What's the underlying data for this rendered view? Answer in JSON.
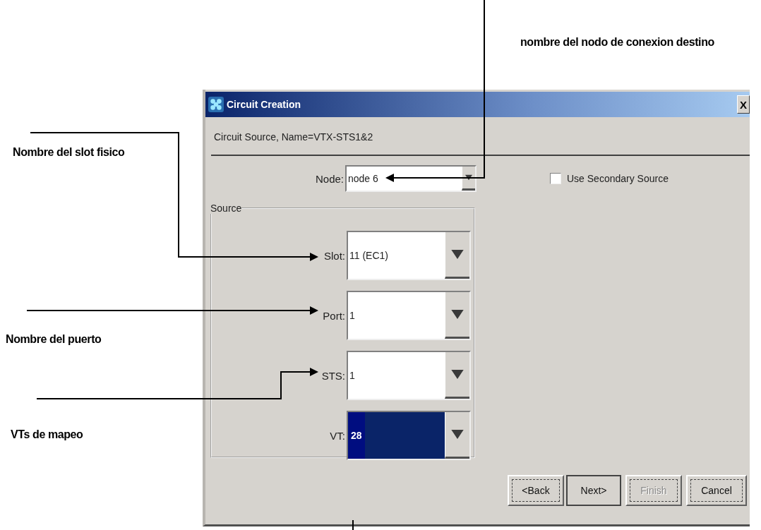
{
  "annotations": [
    {
      "text": "nombre del nodo de conexion destino"
    },
    {
      "text": "Nombre del slot fisico"
    },
    {
      "text": "Nombre del puerto"
    },
    {
      "text": "VTs de mapeo"
    }
  ],
  "window": {
    "title": "Circuit Creation",
    "close": "X"
  },
  "header": "Circuit Source, Name=VTX-STS1&2",
  "node": {
    "label": "Node:",
    "value": "node 6"
  },
  "use_secondary_source": {
    "label": "Use Secondary Source",
    "checked": false
  },
  "source_group": {
    "title": "Source",
    "fields": [
      {
        "label": "Slot:",
        "value": "11 (EC1)",
        "selected": false
      },
      {
        "label": "Port:",
        "value": "1",
        "selected": false
      },
      {
        "label": "STS:",
        "value": "1",
        "selected": false
      },
      {
        "label": "VT:",
        "value": "28",
        "selected": true
      }
    ]
  },
  "buttons": [
    {
      "label": "<Back",
      "disabled": false,
      "default": false
    },
    {
      "label": "Next>",
      "disabled": false,
      "default": true
    },
    {
      "label": "Finish",
      "disabled": true,
      "default": false
    },
    {
      "label": "Cancel",
      "disabled": false,
      "default": false
    }
  ]
}
